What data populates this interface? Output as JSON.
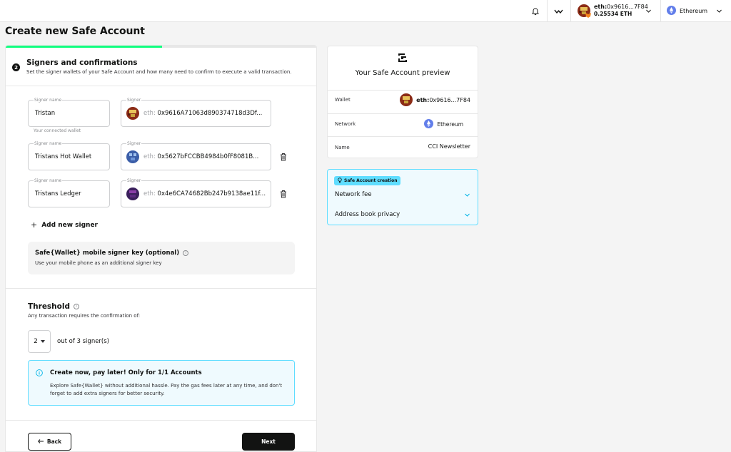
{
  "topbar": {
    "account_prefix": "eth:",
    "account_address": "0x9616...7F84",
    "balance": "0.25534 ETH",
    "network": "Ethereum"
  },
  "page_title": "Create new Safe Account",
  "progress": 0.5,
  "step": {
    "number": "2",
    "title": "Signers and confirmations",
    "subtitle": "Set the signer wallets of your Safe Account and how many need to confirm to execute a valid transaction."
  },
  "signers": [
    {
      "name_label": "Signer name",
      "name": "Tristan",
      "addr_label": "Signer",
      "prefix": "eth:",
      "address": "0x9616A71063d890374718d3Df...",
      "helper": "Your connected wallet"
    },
    {
      "name_label": "Signer name",
      "name": "Tristans Hot Wallet",
      "addr_label": "Signer",
      "prefix": "eth:",
      "address": "0x5627bFCCBB4984b0fF8081B...",
      "helper": ""
    },
    {
      "name_label": "Signer name",
      "name": "Tristans Ledger",
      "addr_label": "Signer",
      "prefix": "eth:",
      "address": "0x4e6CA74682Bb247b9138ae11f...",
      "helper": ""
    }
  ],
  "add_signer": "Add new signer",
  "mobile": {
    "title": "Safe{Wallet} mobile signer key (optional)",
    "subtitle": "Use your mobile phone as an additional signer key"
  },
  "threshold": {
    "title": "Threshold",
    "subtitle": "Any transaction requires the confirmation of:",
    "value": "2",
    "out_of": "out of 3 signer(s)"
  },
  "pay_later": {
    "title": "Create now, pay later! Only for 1/1 Accounts",
    "description": "Explore Safe{Wallet} without additional hassle. Pay the gas fees later at any time, and don't forget to add extra signers for better security."
  },
  "buttons": {
    "back": "Back",
    "next": "Next"
  },
  "preview": {
    "title": "Your Safe Account preview",
    "wallet_label": "Wallet",
    "wallet_prefix": "eth:",
    "wallet_value": "0x9616...7F84",
    "network_label": "Network",
    "network_value": "Ethereum",
    "name_label": "Name",
    "name_value": "CCI Newsletter"
  },
  "creation": {
    "badge": "Safe Account creation",
    "items": [
      "Network fee",
      "Address book privacy"
    ]
  },
  "colors": {
    "accent": "#12ff80",
    "info": "#5fddff",
    "info_bg": "#effafe",
    "eth": "#627eea"
  }
}
